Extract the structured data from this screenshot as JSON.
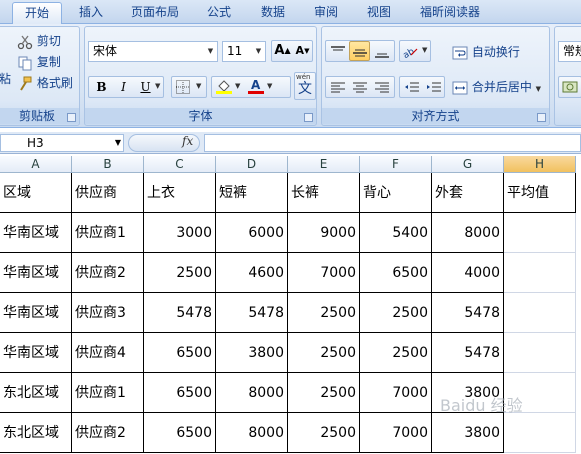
{
  "tabs": [
    {
      "label": "开始",
      "active": true
    },
    {
      "label": "插入",
      "active": false
    },
    {
      "label": "页面布局",
      "active": false
    },
    {
      "label": "公式",
      "active": false
    },
    {
      "label": "数据",
      "active": false
    },
    {
      "label": "审阅",
      "active": false
    },
    {
      "label": "视图",
      "active": false
    },
    {
      "label": "福昕阅读器",
      "active": false
    }
  ],
  "clipboard": {
    "cut": "剪切",
    "copy": "复制",
    "format_painter": "格式刷",
    "paste_fragment": "粘",
    "label": "剪贴板"
  },
  "font": {
    "name": "宋体",
    "size": "11",
    "grow": "A",
    "shrink": "A",
    "bold": "B",
    "italic": "I",
    "underline": "U",
    "phonetic_top": "wén",
    "phonetic_char": "文",
    "label": "字体"
  },
  "alignment": {
    "wrap_text": "自动换行",
    "merge_center": "合并后居中",
    "label": "对齐方式"
  },
  "number": {
    "format": "常规"
  },
  "formula_bar": {
    "cell_ref": "H3",
    "fx": "fx",
    "formula": ""
  },
  "columns": [
    "A",
    "B",
    "C",
    "D",
    "E",
    "F",
    "G",
    "H"
  ],
  "selected_column": "H",
  "table": {
    "headers": [
      "区域",
      "供应商",
      "上衣",
      "短裤",
      "长裤",
      "背心",
      "外套",
      "平均值"
    ],
    "rows": [
      [
        "华南区域",
        "供应商1",
        "3000",
        "6000",
        "9000",
        "5400",
        "8000",
        ""
      ],
      [
        "华南区域",
        "供应商2",
        "2500",
        "4600",
        "7000",
        "6500",
        "4000",
        ""
      ],
      [
        "华南区域",
        "供应商3",
        "5478",
        "5478",
        "2500",
        "2500",
        "5478",
        ""
      ],
      [
        "华南区域",
        "供应商4",
        "6500",
        "3800",
        "2500",
        "2500",
        "5478",
        ""
      ],
      [
        "东北区域",
        "供应商1",
        "6500",
        "8000",
        "2500",
        "7000",
        "3800",
        ""
      ],
      [
        "东北区域",
        "供应商2",
        "6500",
        "8000",
        "2500",
        "7000",
        "3800",
        ""
      ]
    ]
  },
  "watermark": "Baidu 经验",
  "colors": {
    "ribbon_text": "#15428b",
    "selected_header": "#f1c15f",
    "font_color_bar": "#e00000",
    "fill_color_bar": "#ffff00"
  },
  "icons": [
    "scissors-icon",
    "copy-icon",
    "format-painter-icon",
    "paste-icon",
    "borders-icon",
    "fill-color-icon",
    "font-color-icon",
    "align-top-icon",
    "align-middle-icon",
    "align-bottom-icon",
    "orientation-icon",
    "align-left-icon",
    "align-center-icon",
    "align-right-icon",
    "decrease-indent-icon",
    "increase-indent-icon",
    "wrap-text-icon",
    "merge-center-icon",
    "number-format-icon",
    "fx-icon"
  ]
}
